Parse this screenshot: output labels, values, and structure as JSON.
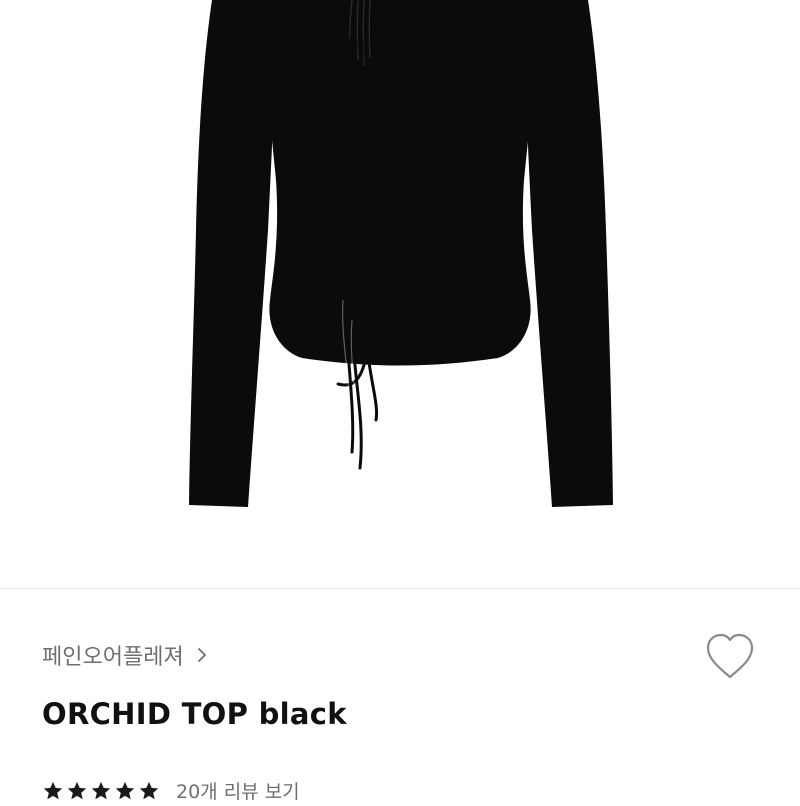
{
  "product": {
    "brand": "페인오어플레져",
    "name": "ORCHID TOP black",
    "image_alt": "black long-sleeve top with drawstring ties",
    "rating": 5,
    "rating_max": 5,
    "reviews_link": "20개 리뷰 보기"
  },
  "icons": {
    "brand_chevron": "chevron-right-icon",
    "wishlist": "heart-outline-icon",
    "star": "star-filled-icon"
  },
  "colors": {
    "garment": "#0b0b0b",
    "star": "#1a1a1a",
    "muted_text": "#6f6f6f",
    "title_text": "#111111"
  }
}
